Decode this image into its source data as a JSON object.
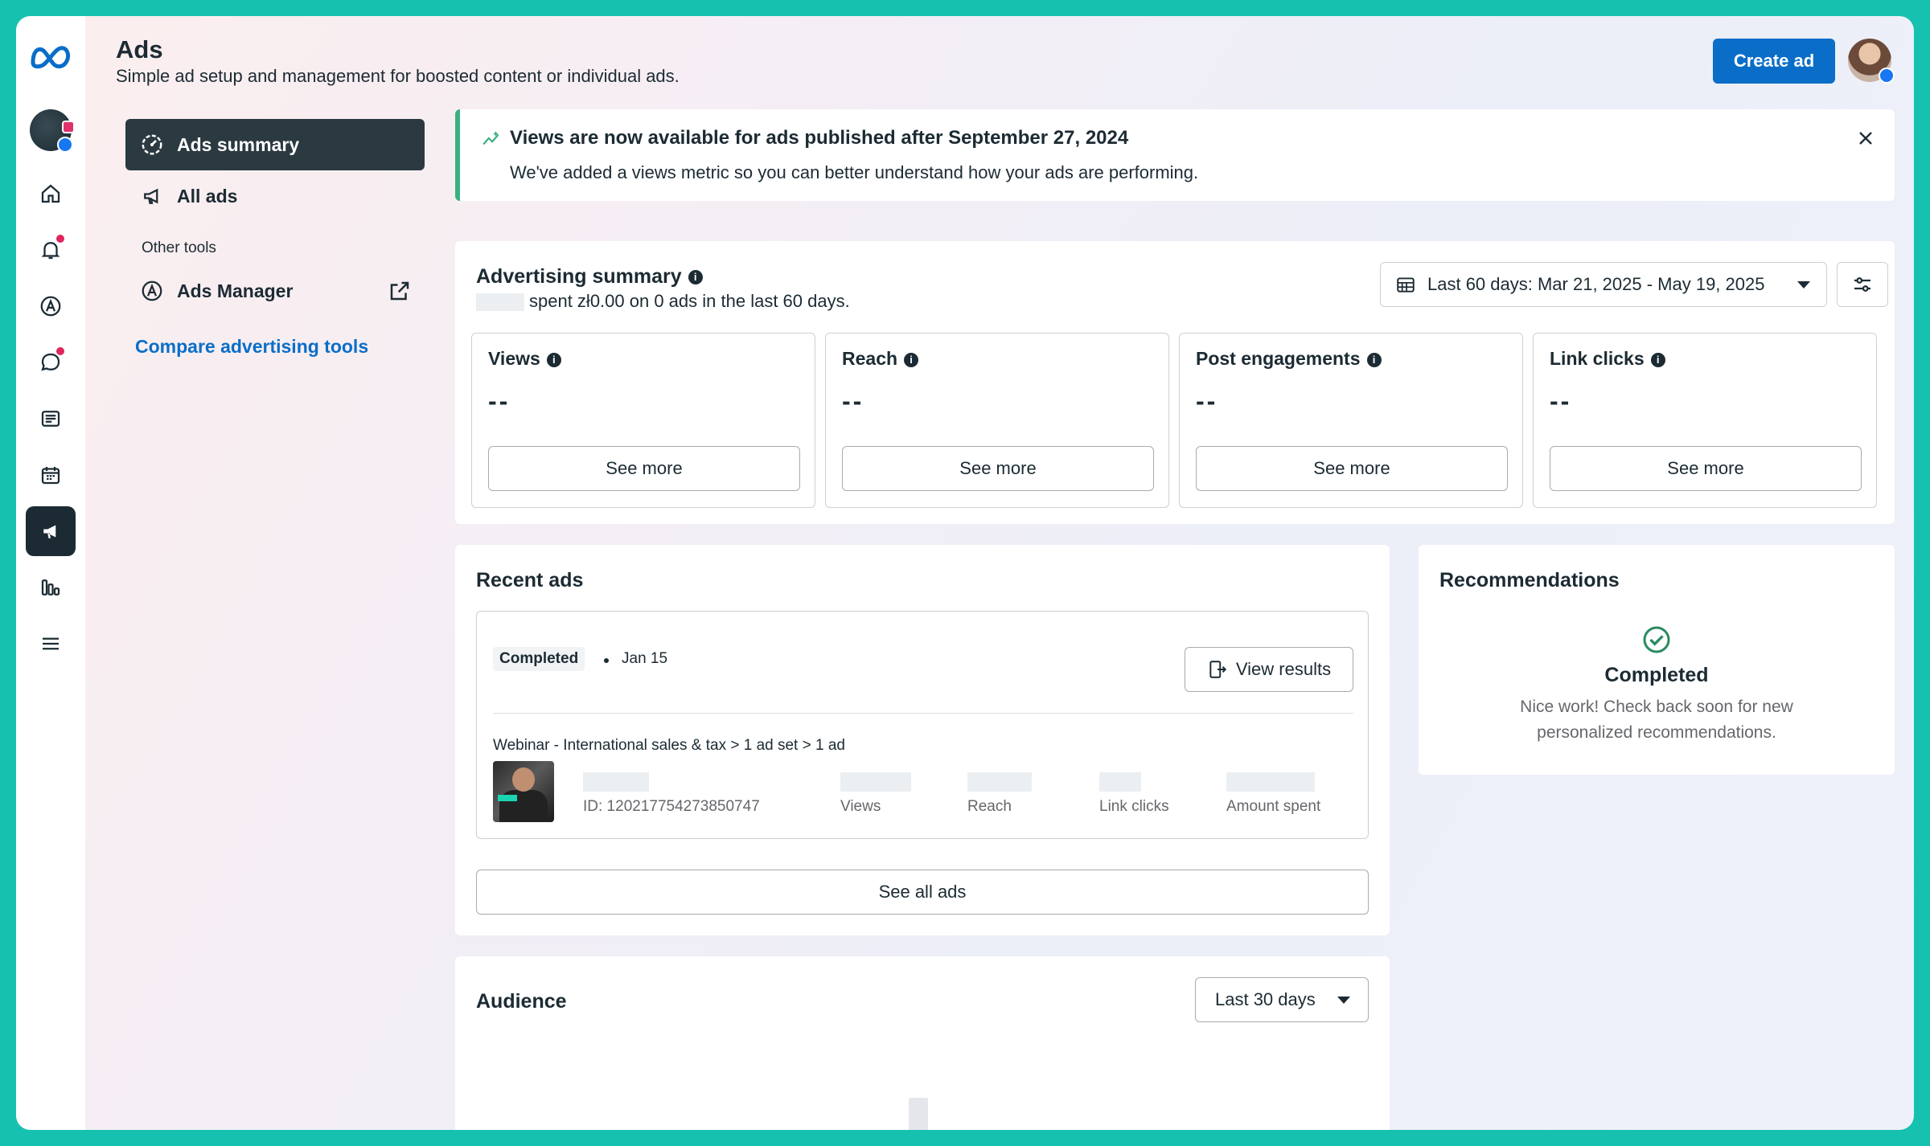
{
  "header": {
    "title": "Ads",
    "subtitle": "Simple ad setup and management for boosted content or individual ads.",
    "create_label": "Create ad"
  },
  "nav": {
    "items": [
      {
        "label": "Ads summary",
        "icon": "dashboard-gauge-icon",
        "active": true
      },
      {
        "label": "All ads",
        "icon": "megaphone-icon"
      }
    ],
    "section_label": "Other tools",
    "tools": [
      {
        "label": "Ads Manager",
        "icon": "ads-manager-icon"
      }
    ],
    "compare_link": "Compare advertising tools"
  },
  "banner": {
    "title": "Views are now available for ads published after September 27, 2024",
    "text": "We've added a views metric so you can better understand how your ads are performing."
  },
  "summary": {
    "title": "Advertising summary",
    "subtitle": "spent zł0.00 on 0 ads in the last 60 days.",
    "date_range": "Last 60 days: Mar 21, 2025 - May 19, 2025",
    "metrics": [
      {
        "label": "Views",
        "value": "--",
        "button": "See more"
      },
      {
        "label": "Reach",
        "value": "--",
        "button": "See more"
      },
      {
        "label": "Post engagements",
        "value": "--",
        "button": "See more"
      },
      {
        "label": "Link clicks",
        "value": "--",
        "button": "See more"
      }
    ]
  },
  "recent_ads": {
    "title": "Recent ads",
    "ad": {
      "status": "Completed",
      "date": "Jan 15",
      "view_results": "View results",
      "path": "Webinar - International sales & tax > 1 ad set > 1 ad",
      "id": "ID: 120217754273850747",
      "stats": [
        "Views",
        "Reach",
        "Link clicks",
        "Amount spent"
      ]
    },
    "see_all": "See all ads"
  },
  "recommendations": {
    "title": "Recommendations",
    "status": "Completed",
    "text": "Nice work! Check back soon for new personalized recommendations."
  },
  "audience": {
    "title": "Audience",
    "range": "Last 30 days"
  },
  "colors": {
    "accent": "#0a6ec8",
    "banner_bar": "#3bb07f",
    "text": "#1c2b33",
    "notification": "#e0245e"
  }
}
